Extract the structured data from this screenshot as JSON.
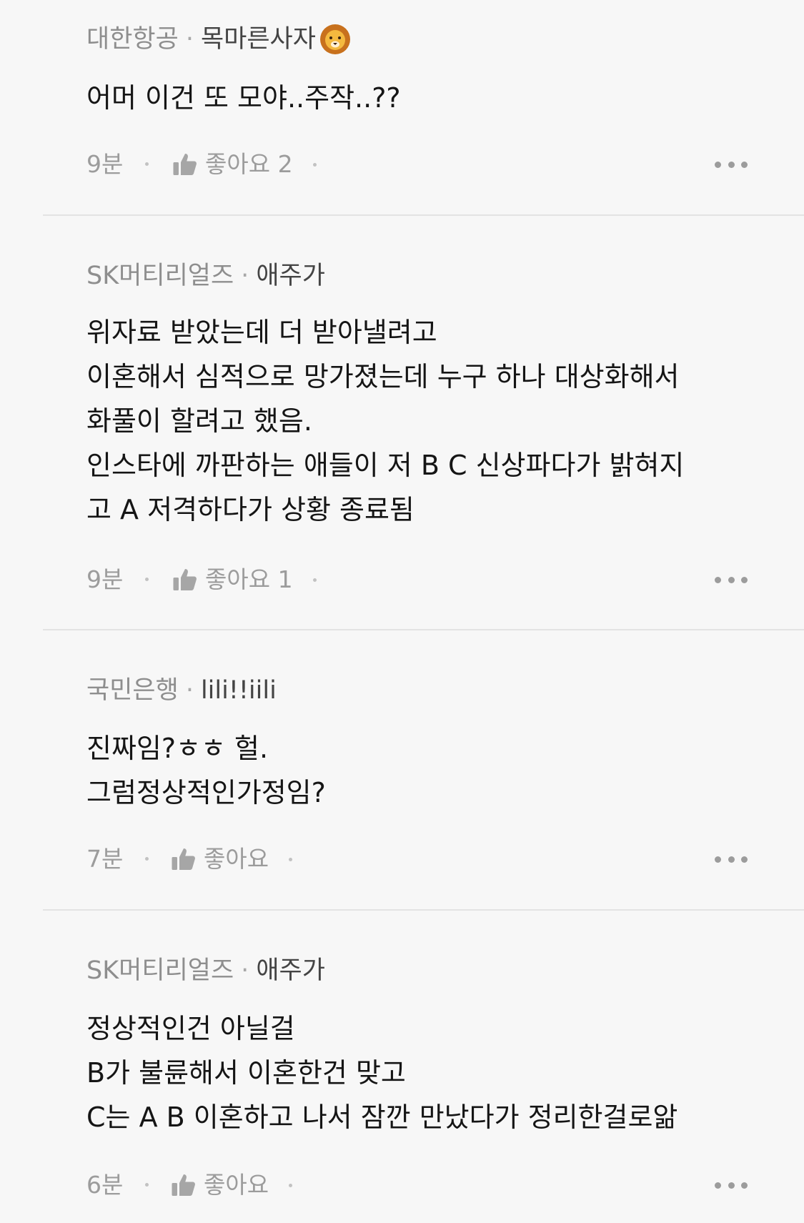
{
  "comments": [
    {
      "company": "대한항공",
      "separator": "·",
      "nickname": "목마른사자",
      "avatar_icon": "lion-emoji-icon",
      "text": "어머 이건 또 모야..주작..??",
      "time": "9분",
      "like_label": "좋아요 2"
    },
    {
      "company": "SK머티리얼즈",
      "separator": "·",
      "nickname": "애주가",
      "text": "위자료 받았는데 더 받아낼려고\n이혼해서 심적으로 망가졌는데 누구 하나 대상화해서\n화풀이 할려고 했음.\n인스타에 까판하는 애들이 저 B C 신상파다가 밝혀지\n고 A 저격하다가 상황 종료됨",
      "time": "9분",
      "like_label": "좋아요 1"
    },
    {
      "company": "국민은행",
      "separator": "·",
      "nickname": "lili!!iili",
      "text": "진짜임?ㅎㅎ 헐.\n그럼정상적인가정임?",
      "time": "7분",
      "like_label": "좋아요"
    },
    {
      "company": "SK머티리얼즈",
      "separator": "·",
      "nickname": "애주가",
      "text": "정상적인건 아닐걸\nB가 불륜해서 이혼한건 맞고\nC는 A B 이혼하고 나서 잠깐 만났다가 정리한걸로앎",
      "time": "6분",
      "like_label": "좋아요"
    }
  ],
  "icons": {
    "like": "thumbs-up-icon",
    "more": "more-dots-icon"
  }
}
